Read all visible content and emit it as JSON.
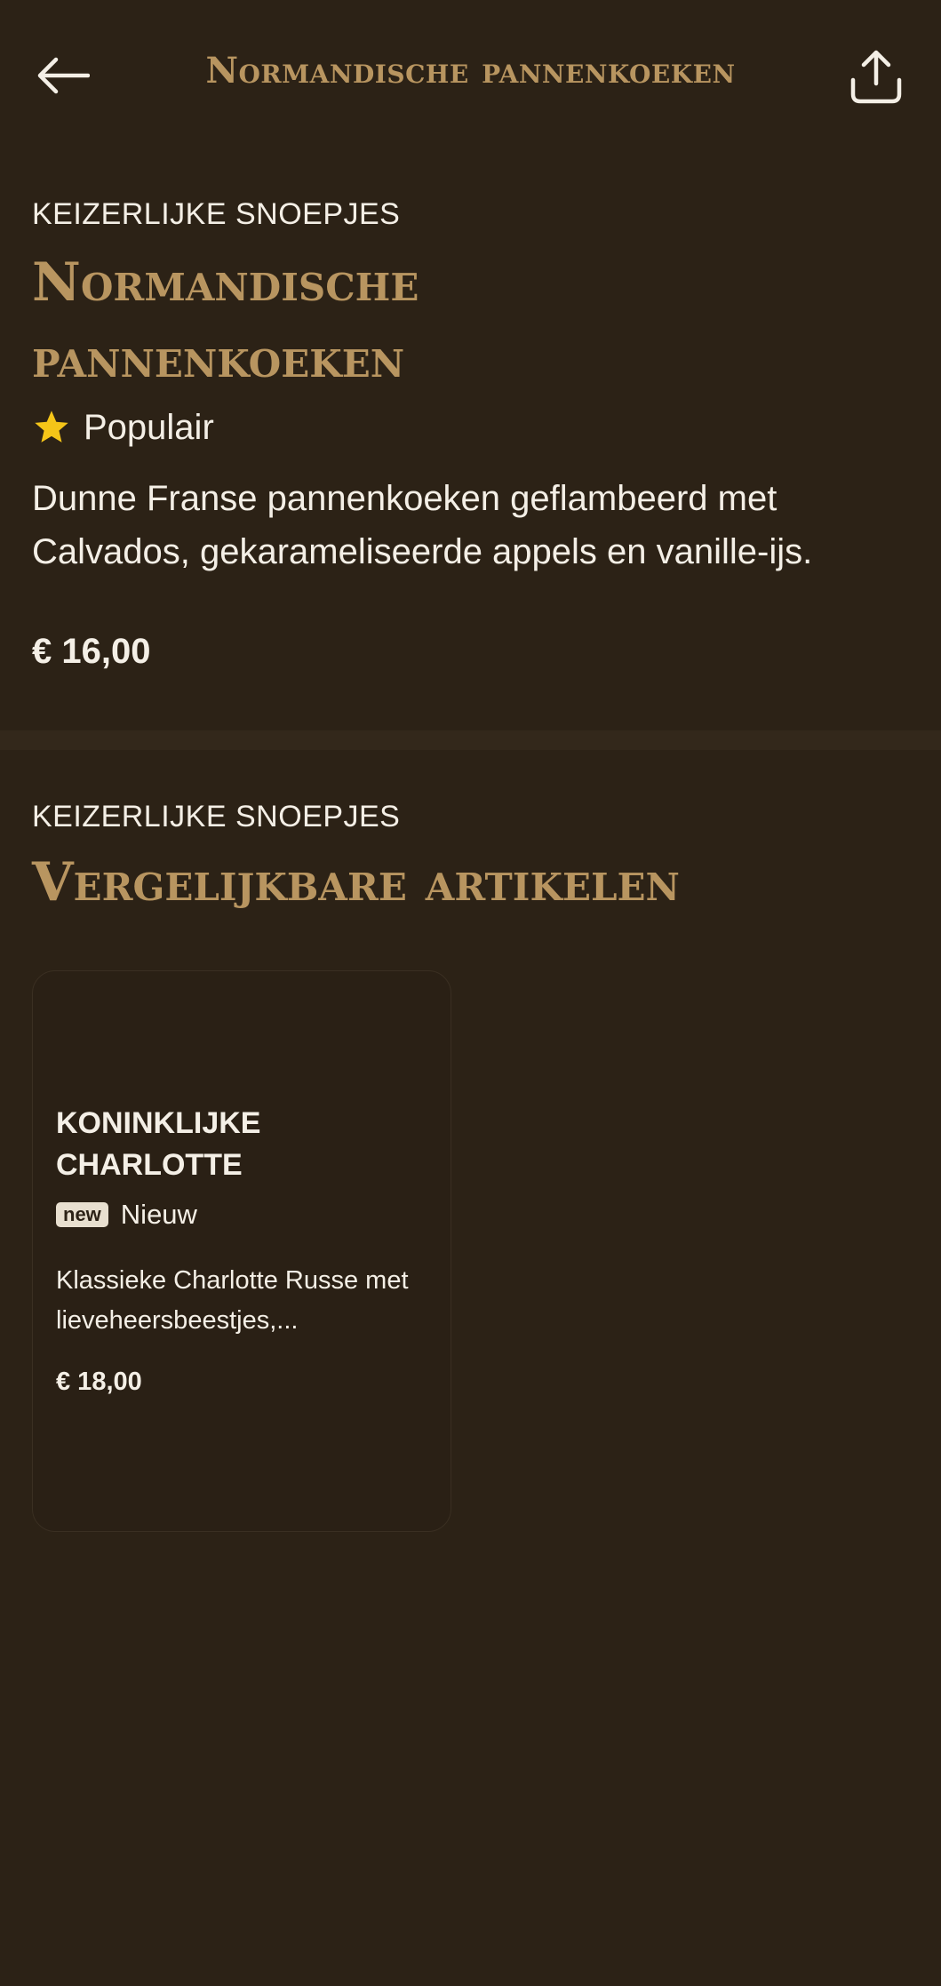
{
  "header": {
    "title": "Normandische pannenkoeken",
    "back_icon": "arrow-left-icon",
    "share_icon": "share-icon"
  },
  "product": {
    "category": "KEIZERLIJKE SNOEPJES",
    "title": "Normandische pannenkoeken",
    "badge": {
      "icon": "star-icon",
      "label": "Populair"
    },
    "description": "Dunne Franse pannenkoeken geflambeerd met Calvados, gekarameliseerde appels en vanille-ijs.",
    "price": "€ 16,00"
  },
  "similar": {
    "category": "KEIZERLIJKE SNOEPJES",
    "title": "Vergelijkbare artikelen",
    "items": [
      {
        "title": "KONINKLIJKE CHARLOTTE",
        "tag": "new",
        "badge_label": "Nieuw",
        "description": "Klassieke Charlotte Russe met lieveheersbeestjes,...",
        "price": "€ 18,00"
      }
    ]
  },
  "colors": {
    "background": "#2c2216",
    "accent": "#b89560",
    "text": "#f4efe6",
    "star": "#f5c518"
  }
}
